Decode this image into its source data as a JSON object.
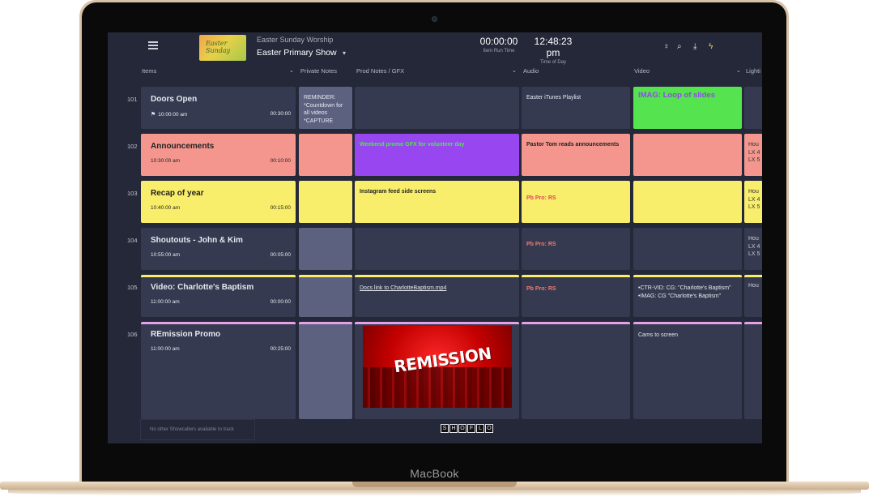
{
  "device": {
    "brand": "MacBook"
  },
  "header": {
    "show_subtitle": "Easter Sunday Worship",
    "show_title": "Easter Primary Show",
    "thumb_text": "Easter Sunday",
    "item_run_time": {
      "value": "00:00:00",
      "label": "Item Run Time"
    },
    "time_of_day": {
      "value": "12:48:23 pm",
      "label": "Time of Day"
    }
  },
  "columns": [
    "Items",
    "Private Notes",
    "Prod Notes / GFX",
    "Audio",
    "Video",
    "Lighti"
  ],
  "rows": [
    {
      "num": "101",
      "title": "Doors Open",
      "start": "10:00:00 am",
      "dur": "00:30:00",
      "flag": true,
      "private": "REMINDER: *Countdown for all videos *CAPTURE",
      "prod": "",
      "audio": "Easter iTunes Playlist",
      "video": "IMAG: Loop of slides",
      "light": ""
    },
    {
      "num": "102",
      "title": "Announcements",
      "start": "10:30:00 am",
      "dur": "00:10:00",
      "private": "",
      "prod": "Weekend promo GFX for volunteer day",
      "audio": "Pastor Tom reads announcements",
      "video": "",
      "light": "Hou LX 4 LX 5"
    },
    {
      "num": "103",
      "title": "Recap of year",
      "start": "10:40:00 am",
      "dur": "00:15:00",
      "private": "",
      "prod": "Instagram feed side screens",
      "audio": "Pb Pro: RS",
      "video": "",
      "light": "Hou LX 4 LX 5"
    },
    {
      "num": "104",
      "title": "Shoutouts - John & Kim",
      "start": "10:55:00 am",
      "dur": "00:05:00",
      "private": "",
      "prod": "",
      "audio": "Pb Pro: RS",
      "video": "",
      "light": "Hou LX 4 LX 5"
    },
    {
      "num": "105",
      "title": "Video: Charlotte's Baptism",
      "start": "11:00:00 am",
      "dur": "00:00:00",
      "private": "",
      "prod": "Docs link to CharlotteBaptism.mp4",
      "audio": "Pb Pro: RS",
      "video": "•CTR-VID: CG: \"Charlotte's Baptism\" •IMAG: CG \"Charlotte's Baptism\"",
      "light": "Hou"
    },
    {
      "num": "106",
      "title": "REmission Promo",
      "start": "11:00:00 am",
      "dur": "00:25:00",
      "private": "",
      "prod_image_text": "REMISSION",
      "audio": "",
      "video": "Cams to screen",
      "light": ""
    }
  ],
  "footer": {
    "note": "No other Showcallers available to track",
    "logo": [
      "S",
      "H",
      "O",
      "F",
      "L",
      "O"
    ]
  },
  "colors": {
    "red_row": "#f5968e",
    "yellow_row": "#f9ee6b",
    "green": "#55e34f",
    "purple": "#9746f0",
    "dark_cell": "#353a50",
    "gray_cell": "#5c6180"
  }
}
